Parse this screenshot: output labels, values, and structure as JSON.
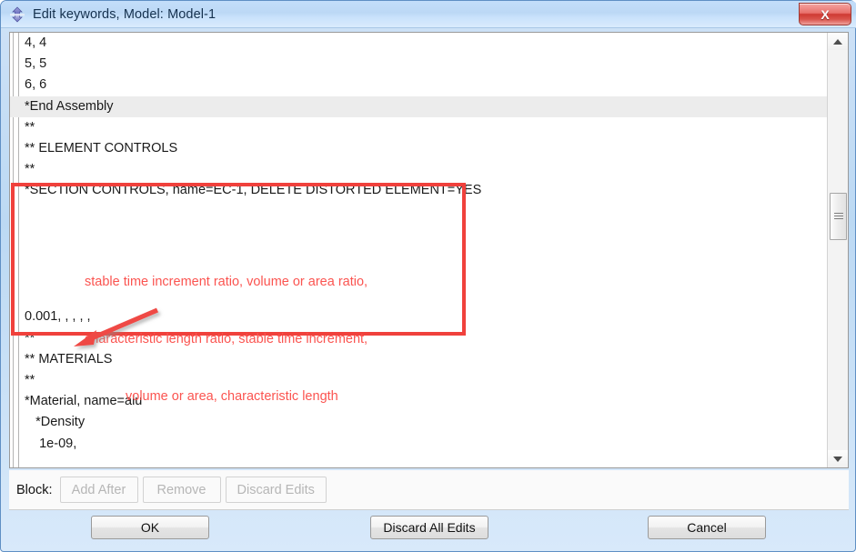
{
  "window": {
    "title": "Edit keywords, Model: Model-1",
    "icon": "abaqus-diamond-icon",
    "close_label": "X",
    "accent_blue": "#bcd9f3",
    "annotation_red": "#fb5450",
    "box_red": "#f0413c"
  },
  "editor": {
    "lines": [
      {
        "text": "4, 4",
        "highlight": false
      },
      {
        "text": "5, 5",
        "highlight": false
      },
      {
        "text": "6, 6",
        "highlight": false
      },
      {
        "text": "*End Assembly",
        "highlight": true
      },
      {
        "text": "**",
        "highlight": false
      },
      {
        "text": "** ELEMENT CONTROLS",
        "highlight": false
      },
      {
        "text": "**",
        "highlight": false
      },
      {
        "text": "*SECTION CONTROLS, name=EC-1, DELETE DISTORTED ELEMENT=YES",
        "highlight": false
      },
      {
        "text": "",
        "highlight": false
      },
      {
        "text": "",
        "highlight": false
      },
      {
        "text": "",
        "highlight": false
      },
      {
        "text": "",
        "highlight": false
      },
      {
        "text": "",
        "highlight": false
      },
      {
        "text": "0.001, , , , ,",
        "highlight": false
      },
      {
        "text": "**",
        "highlight": false
      },
      {
        "text": "** MATERIALS",
        "highlight": false
      },
      {
        "text": "**",
        "highlight": false
      },
      {
        "text": "*Material, name=alu",
        "highlight": false
      },
      {
        "text": "   *Density",
        "highlight": false
      },
      {
        "text": "    1e-09,",
        "highlight": false
      }
    ]
  },
  "annotation": {
    "line1": "stable time increment ratio, volume or area ratio,",
    "line2": "characteristic length ratio, stable time increment,",
    "line3": "volume or area, characteristic length"
  },
  "scrollbar": {
    "up_arrow": "scroll-up-arrow-icon",
    "down_arrow": "scroll-down-arrow-icon"
  },
  "block_toolbar": {
    "label": "Block:",
    "add_after": "Add After",
    "remove": "Remove",
    "discard_edits": "Discard Edits"
  },
  "footer": {
    "ok": "OK",
    "discard_all_edits": "Discard All Edits",
    "cancel": "Cancel"
  }
}
